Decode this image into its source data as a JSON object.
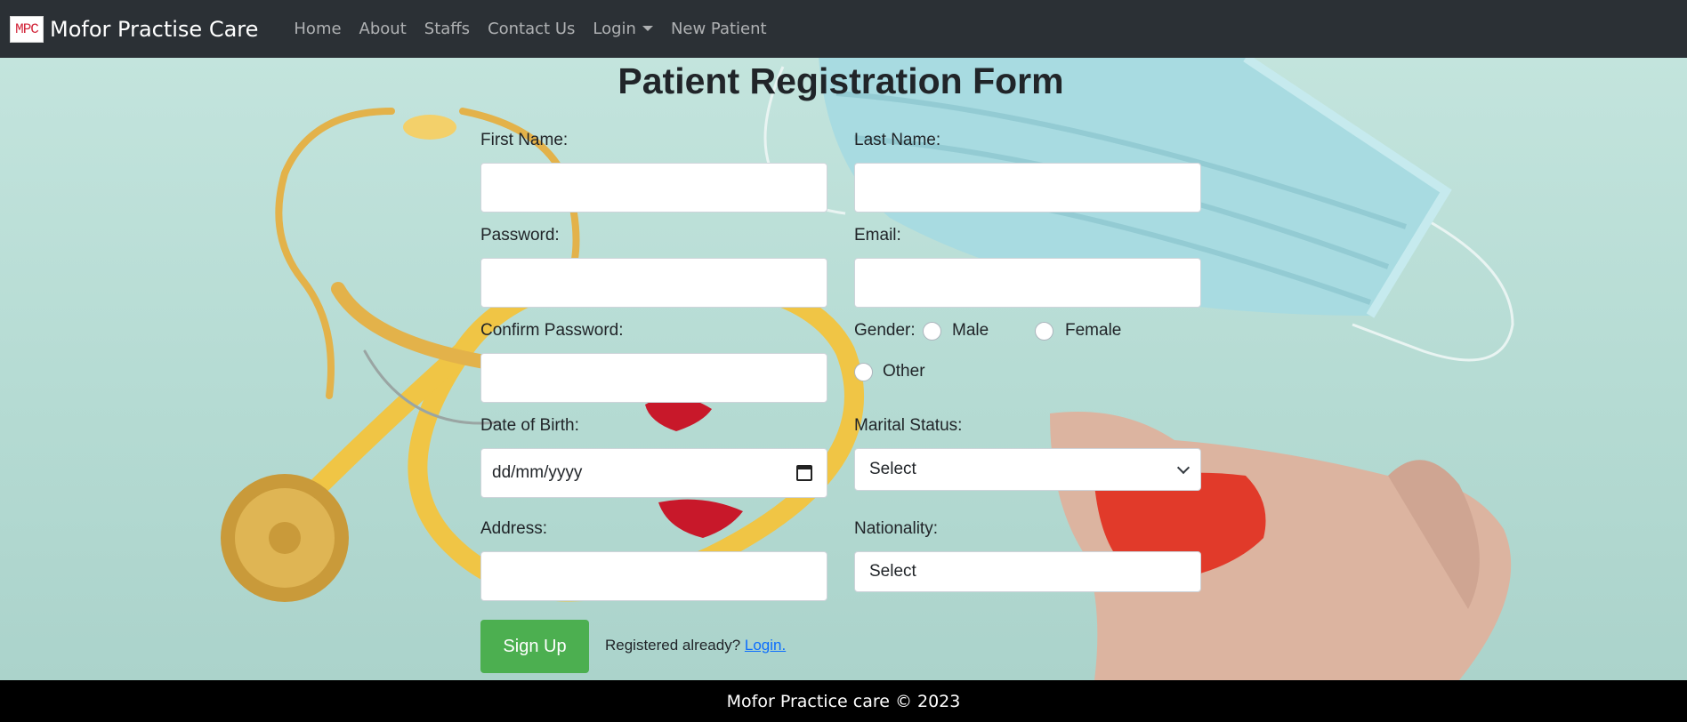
{
  "navbar": {
    "logo_text": "MPC",
    "brand": "Mofor Practise Care",
    "links": [
      "Home",
      "About",
      "Staffs",
      "Contact Us",
      "Login",
      "New Patient"
    ]
  },
  "form": {
    "title": "Patient Registration Form",
    "first_name_label": "First Name:",
    "last_name_label": "Last Name:",
    "password_label": "Password:",
    "email_label": "Email:",
    "confirm_password_label": "Confirm Password:",
    "gender_label": "Gender:",
    "gender_options": [
      "Male",
      "Female",
      "Other"
    ],
    "dob_label": "Date of Birth:",
    "dob_placeholder": "dd/mm/yyyy",
    "marital_label": "Marital Status:",
    "marital_value": "Select",
    "address_label": "Address:",
    "nationality_label": "Nationality:",
    "nationality_value": "Select",
    "signup_label": "Sign Up",
    "registered_text": "Registered already?",
    "login_link": "Login."
  },
  "footer": {
    "text": "Mofor Practice care © 2023"
  },
  "colors": {
    "navbar_bg": "#2b3035",
    "button_green": "#4caf50",
    "link_blue": "#0d6efd",
    "footer_bg": "#000000"
  }
}
